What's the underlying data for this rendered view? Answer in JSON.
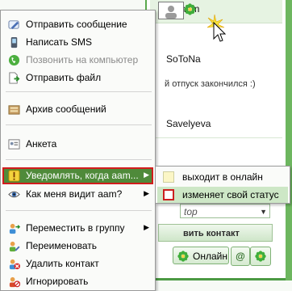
{
  "background_window": {
    "contacts": [
      {
        "name": "aam",
        "active": true
      },
      {
        "name": "SoToNa"
      },
      {
        "name": "й отпуск закончился :)"
      },
      {
        "name": "Savelyeva"
      }
    ],
    "search_value": "top",
    "add_contact_label": "вить контакт",
    "status_online_label": "Онлайн",
    "at_label": "@"
  },
  "menu": {
    "items": [
      {
        "label": "Отправить сообщение",
        "icon": "pencil-icon"
      },
      {
        "label": "Написать SMS",
        "icon": "sms-icon"
      },
      {
        "label": "Позвонить на компьютер",
        "icon": "phone-icon",
        "disabled": true
      },
      {
        "label": "Отправить файл",
        "icon": "send-file-icon"
      },
      {
        "label": "Архив сообщений",
        "icon": "archive-icon"
      },
      {
        "label": "Анкета",
        "icon": "profile-icon"
      },
      {
        "label": "Уведомлять, когда aam...",
        "icon": "notify-icon",
        "highlighted": true,
        "submenu": true
      },
      {
        "label": "Как меня видит aam?",
        "icon": "eye-icon",
        "submenu": true
      },
      {
        "label": "Переместить в группу",
        "icon": "move-group-icon",
        "submenu": true
      },
      {
        "label": "Переименовать",
        "icon": "rename-icon"
      },
      {
        "label": "Удалить контакт",
        "icon": "delete-contact-icon"
      },
      {
        "label": "Игнорировать",
        "icon": "ignore-icon"
      }
    ]
  },
  "submenu": {
    "items": [
      {
        "label": "выходит в онлайн",
        "checked": false
      },
      {
        "label": "изменяет свой статус",
        "checked": false,
        "highlighted": true
      }
    ]
  },
  "colors": {
    "accent_green": "#4f8a3a",
    "highlight_outline": "#d11c1c"
  }
}
